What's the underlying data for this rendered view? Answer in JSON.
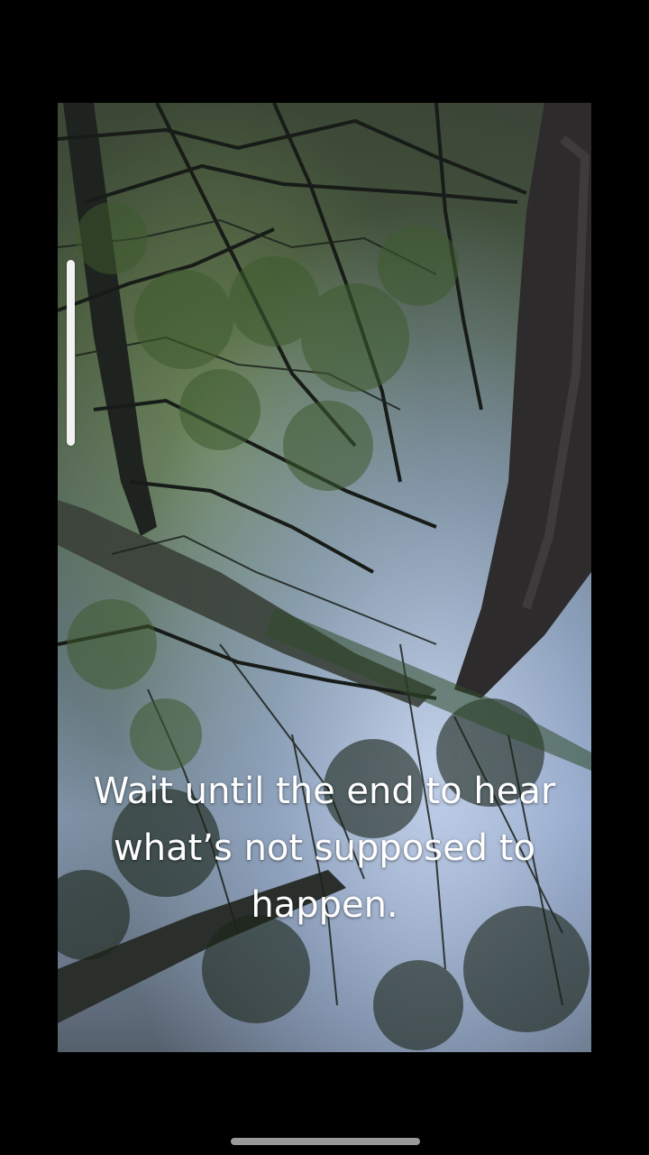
{
  "video": {
    "caption_line1": "Wait until the end to hear",
    "caption_line2": "what’s not supposed to",
    "caption_line3": "happen.",
    "progress_fraction": 0.2
  },
  "colors": {
    "background": "#000000",
    "caption_text": "#ffffff",
    "progress_bar": "#f2f2f2",
    "home_indicator": "#9a9a9a"
  }
}
